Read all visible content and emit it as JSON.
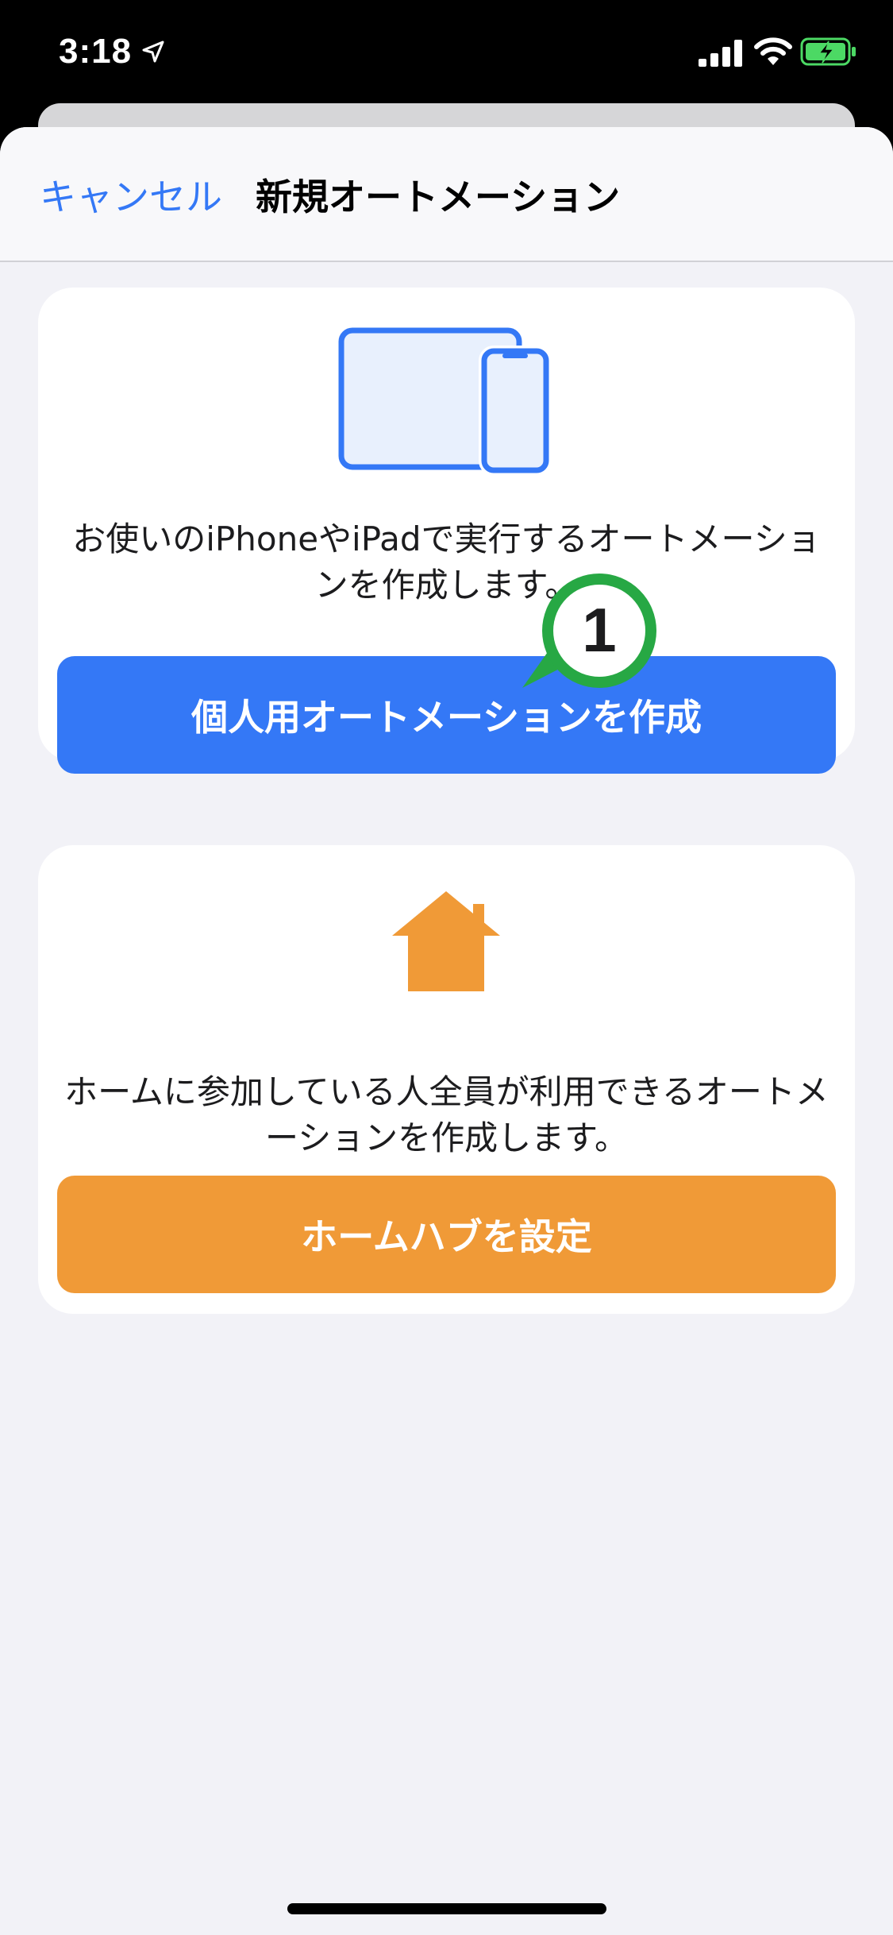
{
  "status_bar": {
    "time": "3:18",
    "icons": [
      "location-arrow-icon",
      "cellular-signal-icon",
      "wifi-icon",
      "battery-charging-icon"
    ],
    "battery_color": "#4cd964"
  },
  "nav": {
    "cancel_label": "キャンセル",
    "title": "新規オートメーション"
  },
  "personal": {
    "icon": "iphone-ipad-icon",
    "description": "お使いのiPhoneやiPadで実行するオートメーションを作成します。",
    "button_label": "個人用オートメーションを作成"
  },
  "home": {
    "icon": "house-icon",
    "description": "ホームに参加している人全員が利用できるオートメーションを作成します。",
    "button_label": "ホームハブを設定"
  },
  "annotation": {
    "number": "1",
    "color": "#27a844"
  },
  "colors": {
    "accent": "#3478f6",
    "home_accent": "#f09a37",
    "background": "#f2f2f7"
  }
}
